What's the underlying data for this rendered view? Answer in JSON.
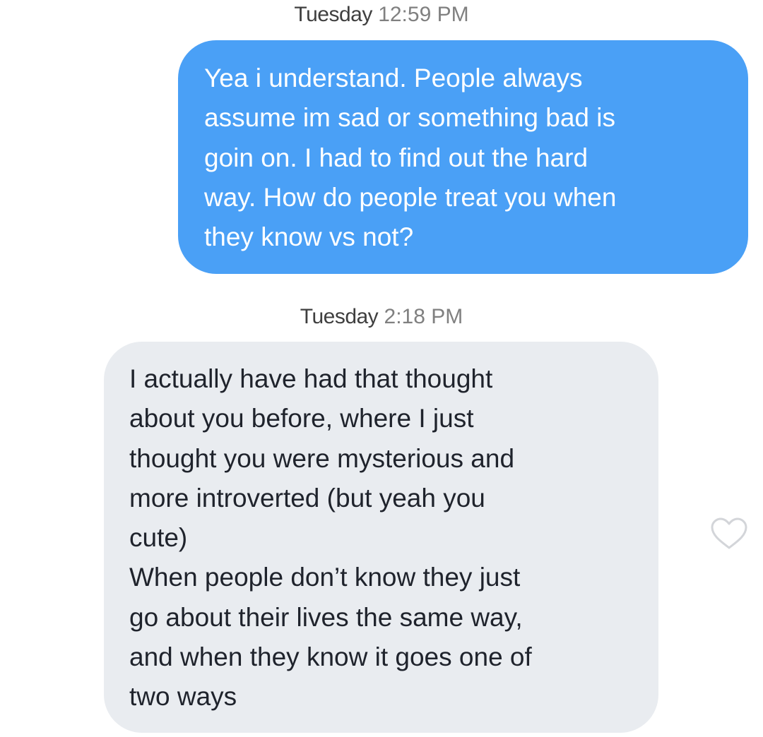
{
  "messages": [
    {
      "timestamp_day": "Tuesday",
      "timestamp_time": "12:59 PM",
      "direction": "sent",
      "text": "Yea i understand. People always\nassume im sad or something bad is\ngoin on. I had to find out the hard\nway. How do people treat you when\nthey know vs not?"
    },
    {
      "timestamp_day": "Tuesday",
      "timestamp_time": "2:18 PM",
      "direction": "received",
      "text": "I actually have had that thought\nabout you before, where I just\nthought you were mysterious and\nmore introverted (but yeah you\ncute)\nWhen people don’t know they just\ngo about their lives the same way,\nand when they know it goes one of\ntwo ways",
      "like_icon": "heart-outline-icon"
    }
  ],
  "colors": {
    "sent_bubble": "#4aa0f6",
    "received_bubble": "#e9ecf0",
    "timestamp_day": "#3f3f3f",
    "timestamp_time": "#808080"
  }
}
